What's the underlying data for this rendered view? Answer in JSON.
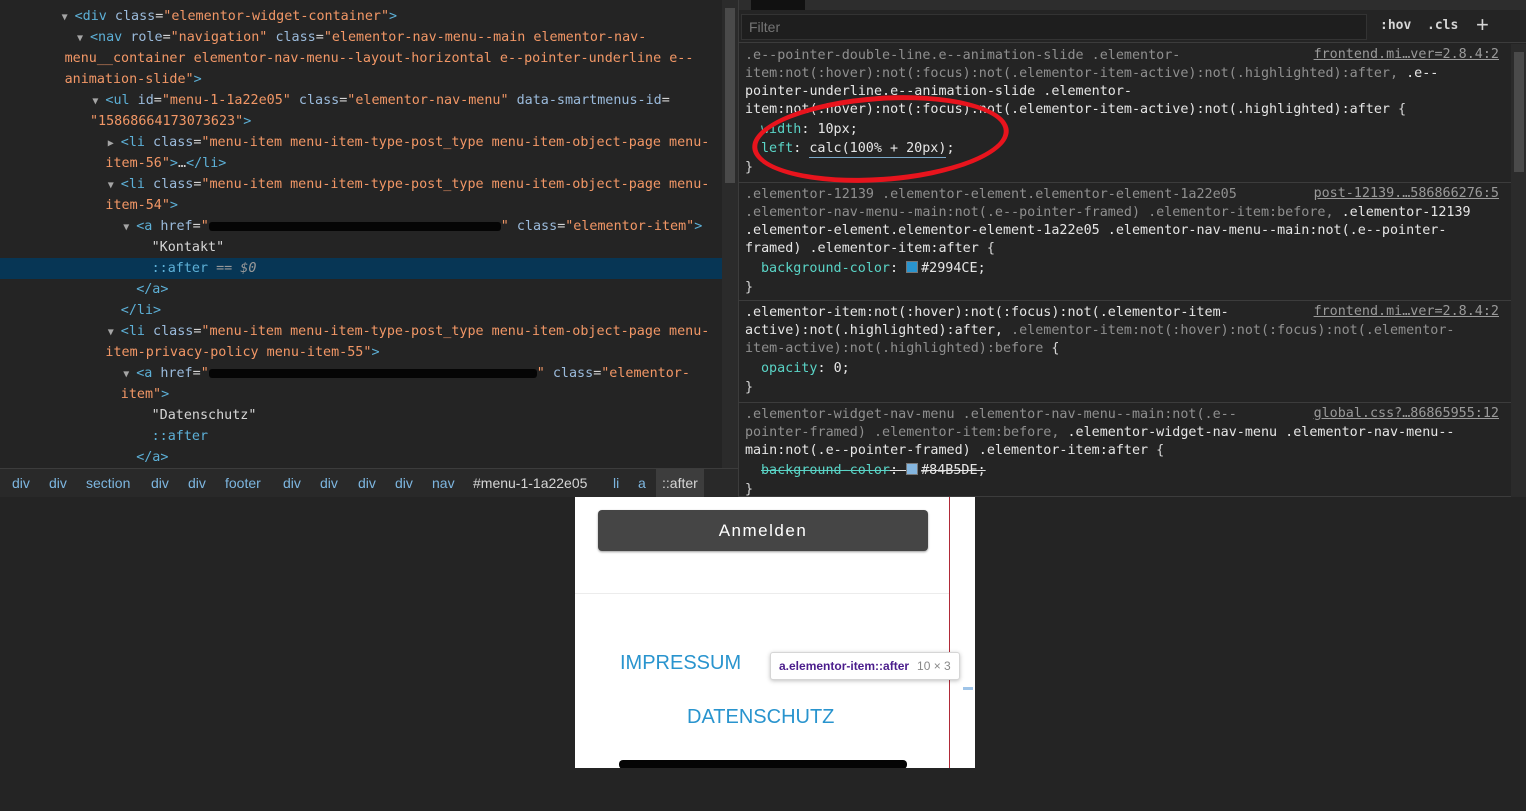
{
  "dom_tree": {
    "lines": [
      {
        "indent": 4,
        "tri": "▼",
        "html": "<span class=\"tag\">&lt;div</span> <span class=\"an\">class</span>=<span class=\"av\">\"elementor-widget-container\"</span><span class=\"tag\">&gt;</span>"
      },
      {
        "indent": 5,
        "tri": "▼",
        "html": "<span class=\"tag\">&lt;nav</span> <span class=\"an\">role</span>=<span class=\"av\">\"navigation\"</span> <span class=\"an\">class</span>=<span class=\"av\">\"elementor-nav-menu--main elementor-nav-</span>"
      },
      {
        "indent": 5,
        "tri": "",
        "html": "<span class=\"av\">menu__container elementor-nav-menu--layout-horizontal e--pointer-underline e--</span>",
        "wrap": true
      },
      {
        "indent": 5,
        "tri": "",
        "html": "<span class=\"av\">animation-slide\"</span><span class=\"tag\">&gt;</span>",
        "wrap": true
      },
      {
        "indent": 6,
        "tri": "▼",
        "html": "<span class=\"tag\">&lt;ul</span> <span class=\"an\">id</span>=<span class=\"av\">\"menu-1-1a22e05\"</span> <span class=\"an\">class</span>=<span class=\"av\">\"elementor-nav-menu\"</span> <span class=\"an\">data-smartmenus-id</span>="
      },
      {
        "indent": 6,
        "tri": "",
        "html": "<span class=\"av\">\"15868664173073623\"</span><span class=\"tag\">&gt;</span>",
        "wrap": true
      },
      {
        "indent": 7,
        "tri": "▶",
        "html": "<span class=\"tag\">&lt;li</span> <span class=\"an\">class</span>=<span class=\"av\">\"menu-item menu-item-type-post_type menu-item-object-page menu-</span>"
      },
      {
        "indent": 7,
        "tri": "",
        "html": "<span class=\"av\">item-56\"</span><span class=\"tag\">&gt;</span>…<span class=\"tag\">&lt;/li&gt;</span>",
        "wrap": true
      },
      {
        "indent": 7,
        "tri": "▼",
        "html": "<span class=\"tag\">&lt;li</span> <span class=\"an\">class</span>=<span class=\"av\">\"menu-item menu-item-type-post_type menu-item-object-page menu-</span>"
      },
      {
        "indent": 7,
        "tri": "",
        "html": "<span class=\"av\">item-54\"</span><span class=\"tag\">&gt;</span>",
        "wrap": true
      },
      {
        "indent": 8,
        "tri": "▼",
        "html": "<span class=\"tag\">&lt;a</span> <span class=\"an\">href</span>=<span class=\"av\">\"</span><span class=\"redact\" style=\"width:292px\"></span><span class=\"av\">\"</span> <span class=\"an\">class</span>=<span class=\"av\">\"elementor-item\"</span><span class=\"tag\">&gt;</span>"
      },
      {
        "indent": 9,
        "tri": "",
        "html": "<span class=\"tx\">\"Kontakt\"</span>"
      },
      {
        "indent": 9,
        "tri": "",
        "html": "<span class=\"ps\">::after</span> <span class=\"eq\">== $0</span>",
        "selected": true
      },
      {
        "indent": 8,
        "tri": "",
        "html": "<span class=\"tag\">&lt;/a&gt;</span>"
      },
      {
        "indent": 7,
        "tri": "",
        "html": "<span class=\"tag\">&lt;/li&gt;</span>"
      },
      {
        "indent": 7,
        "tri": "▼",
        "html": "<span class=\"tag\">&lt;li</span> <span class=\"an\">class</span>=<span class=\"av\">\"menu-item menu-item-type-post_type menu-item-object-page menu-</span>"
      },
      {
        "indent": 7,
        "tri": "",
        "html": "<span class=\"av\">item-privacy-policy menu-item-55\"</span><span class=\"tag\">&gt;</span>",
        "wrap": true
      },
      {
        "indent": 8,
        "tri": "▼",
        "html": "<span class=\"tag\">&lt;a</span> <span class=\"an\">href</span>=<span class=\"av\">\"</span><span class=\"redact\" style=\"width:328px\"></span><span class=\"av\">\"</span> <span class=\"an\">class</span>=<span class=\"av\">\"elementor-</span>"
      },
      {
        "indent": 8,
        "tri": "",
        "html": "<span class=\"av\">item\"</span><span class=\"tag\">&gt;</span>",
        "wrap": true
      },
      {
        "indent": 9,
        "tri": "",
        "html": "<span class=\"tx\">\"Datenschutz\"</span>"
      },
      {
        "indent": 9,
        "tri": "",
        "html": "<span class=\"ps\">::after</span>"
      },
      {
        "indent": 8,
        "tri": "",
        "html": "<span class=\"tag\">&lt;/a&gt;</span>"
      }
    ]
  },
  "breadcrumbs": [
    "div",
    "div",
    "section",
    "div",
    "div",
    "footer",
    "div",
    "div",
    "div",
    "div",
    "nav",
    "#menu-1-1a22e05",
    "li",
    "a",
    "::after"
  ],
  "styles": {
    "filter_placeholder": "Filter",
    "hov_label": ":hov",
    "cls_label": ".cls",
    "plus_label": "+",
    "rules": [
      {
        "source": "frontend.mi…ver=2.8.4:2",
        "selector_lines": [
          "<span class=\"sel-dim\">.e--pointer-double-line.e--animation-slide .elementor-</span>",
          "<span class=\"sel-dim\">item:not(:hover):not(:focus):not(.elementor-item-active):not(.highlighted):after, </span><span class=\"sel-hi\">.e--</span>",
          "<span class=\"sel-hi\">pointer-underline.e--animation-slide .elementor-</span>",
          "<span class=\"sel-hi\">item:not(:hover):not(:focus):not(.elementor-item-active):not(.highlighted):after</span> <span class=\"brace\">{</span>"
        ],
        "props": [
          {
            "name": "width",
            "value": "10px",
            "strike": false
          },
          {
            "name": "left",
            "value": "calc(100% + 20px)",
            "strike": false,
            "underline": true
          }
        ]
      },
      {
        "source": "post-12139.…586866276:5",
        "selector_lines": [
          "<span class=\"sel-dim\">.elementor-12139 .elementor-element.elementor-element-1a22e05</span>",
          "<span class=\"sel-dim\">.elementor-nav-menu--main:not(.e--pointer-framed) .elementor-item:before, </span><span class=\"sel-hi\">.elementor-12139</span>",
          "<span class=\"sel-hi\">.elementor-element.elementor-element-1a22e05 .elementor-nav-menu--main:not(.e--pointer-</span>",
          "<span class=\"sel-hi\">framed) .elementor-item:after</span> <span class=\"brace\">{</span>"
        ],
        "props": [
          {
            "name": "background-color",
            "value": "#2994CE",
            "swatch": "#2994CE",
            "strike": false
          }
        ]
      },
      {
        "source": "frontend.mi…ver=2.8.4:2",
        "selector_lines": [
          "<span class=\"sel-hi\">.elementor-item:not(:hover):not(:focus):not(.elementor-item-</span>",
          "<span class=\"sel-hi\">active):not(.highlighted):after, </span><span class=\"sel-dim\">.elementor-item:not(:hover):not(:focus):not(.elementor-</span>",
          "<span class=\"sel-dim\">item-active):not(.highlighted):before</span> <span class=\"brace\">{</span>"
        ],
        "props": [
          {
            "name": "opacity",
            "value": "0",
            "strike": false
          }
        ]
      },
      {
        "source": "global.css?…86865955:12",
        "selector_lines": [
          "<span class=\"sel-dim\">.elementor-widget-nav-menu .elementor-nav-menu--main:not(.e--</span>",
          "<span class=\"sel-dim\">pointer-framed) .elementor-item:before, </span><span class=\"sel-hi\">.elementor-widget-nav-menu .elementor-nav-menu--</span>",
          "<span class=\"sel-hi\">main:not(.e--pointer-framed) .elementor-item:after</span> <span class=\"brace\">{</span>"
        ],
        "props": [
          {
            "name": "background-color",
            "value": "#84B5DE",
            "swatch": "#84B5DE",
            "strike": true
          }
        ]
      }
    ]
  },
  "preview": {
    "login_button": "Anmelden",
    "nav_impressum": "IMPRESSUM",
    "nav_datenschutz": "DATENSCHUTZ",
    "tooltip_name": "a.elementor-item::after",
    "tooltip_dims": "10 × 3",
    "link_color": "#2994CE"
  }
}
